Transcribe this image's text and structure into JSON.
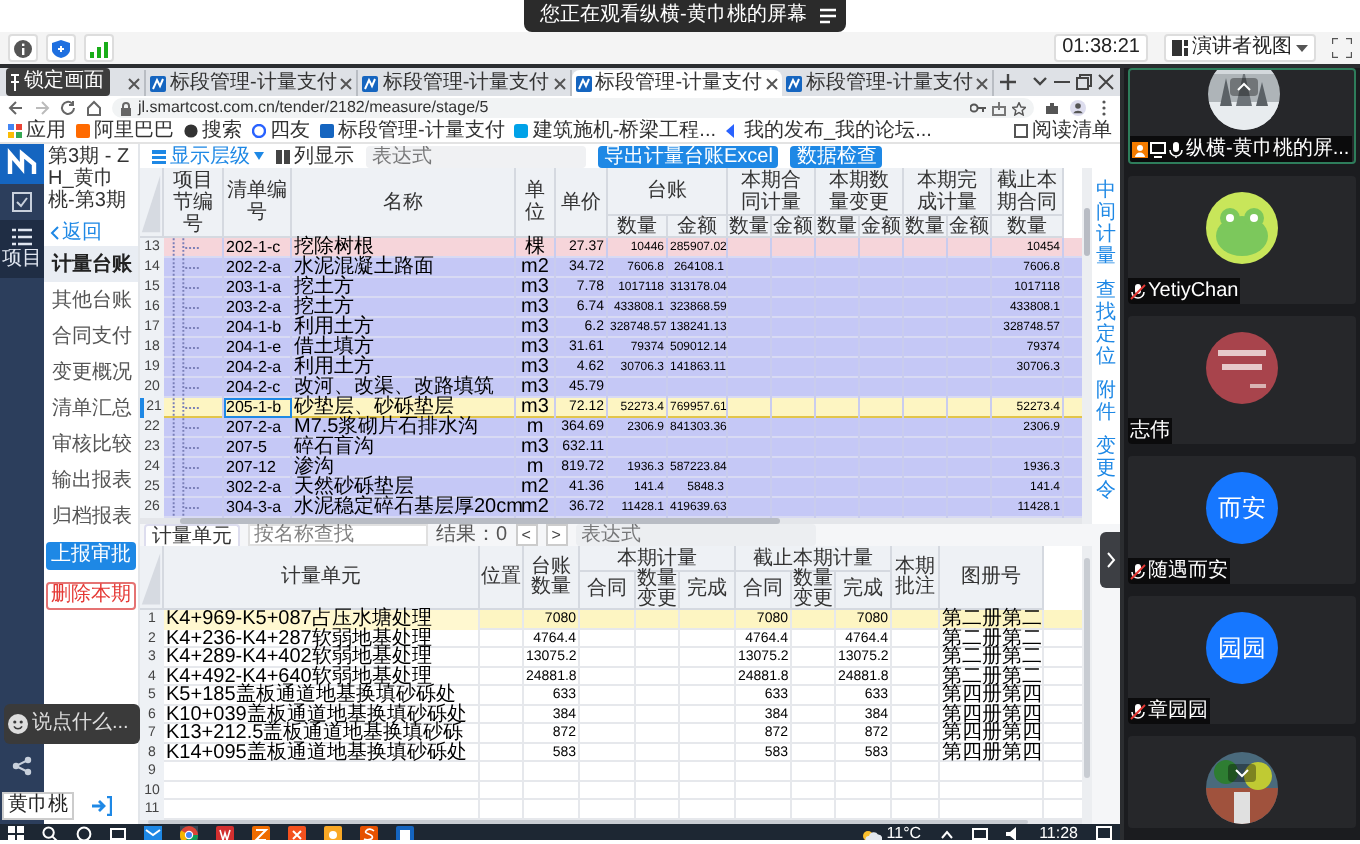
{
  "meeting": {
    "banner": "您正在观看纵横-黄巾桃的屏幕",
    "timer": "01:38:21",
    "view_button": "演讲者视图",
    "lock_overlay": "锁定画面",
    "chat_placeholder": "说点什么...",
    "presenter_label": "黄巾桃"
  },
  "browser": {
    "tabs": [
      {
        "selected": false
      },
      {
        "label": "标段管理-计量支付",
        "selected": false
      },
      {
        "label": "标段管理-计量支付",
        "selected": false
      },
      {
        "label": "标段管理-计量支付",
        "selected": true
      },
      {
        "label": "标段管理-计量支付",
        "selected": false
      }
    ],
    "address": "jl.smartcost.com.cn/tender/2182/measure/stage/5",
    "bookmarks": [
      "应用",
      "阿里巴巴",
      "搜索",
      "四友",
      "标段管理-计量支付",
      "建筑施机-桥梁工程...",
      "我的发布_我的论坛...",
      "阅读清单"
    ]
  },
  "app": {
    "period": "第3期 - ZH_黄巾桃-第3期",
    "rail": [
      {
        "selected": false
      },
      {
        "label": "项目",
        "selected": true
      }
    ],
    "back": "返回",
    "nav": [
      {
        "label": "计量台账",
        "selected": true
      },
      {
        "label": "其他台账",
        "selected": false
      },
      {
        "label": "合同支付",
        "selected": false
      },
      {
        "label": "变更概况",
        "selected": false
      },
      {
        "label": "清单汇总",
        "selected": false
      },
      {
        "label": "审核比较",
        "selected": false
      },
      {
        "label": "输出报表",
        "selected": false
      },
      {
        "label": "归档报表",
        "selected": false
      }
    ],
    "submit_button": "上报审批",
    "delete_button": "删除本期",
    "toolbar": {
      "level_dropdown": "显示层级",
      "columns_button": "列显示",
      "expression_placeholder": "表达式",
      "export_button": "导出计量台账Excel",
      "check_button": "数据检查"
    },
    "ledger": {
      "columns": [
        "项目节编号",
        "清单编号",
        "名称",
        "单位",
        "单价"
      ],
      "groups": [
        {
          "label": "台账",
          "sub": [
            "数量",
            "金额"
          ]
        },
        {
          "label": "本期合同计量",
          "sub": [
            "数量",
            "金额"
          ]
        },
        {
          "label": "本期数量变更",
          "sub": [
            "数量",
            "金额"
          ]
        },
        {
          "label": "本期完成计量",
          "sub": [
            "数量",
            "金额"
          ]
        },
        {
          "label": "截止本期合同",
          "sub": [
            "数量"
          ]
        }
      ],
      "rows": [
        {
          "no": "13",
          "code": "202-1-c",
          "name": "挖除树根",
          "unit": "棵",
          "price": "27.37",
          "ledger_qty": "10446",
          "ledger_amount": "285907.02",
          "to_date_qty": "10454",
          "flagged": true,
          "selected": false
        },
        {
          "no": "14",
          "code": "202-2-a",
          "name": "水泥混凝土路面",
          "unit": "m2",
          "price": "34.72",
          "ledger_qty": "7606.8",
          "ledger_amount": "264108.1",
          "to_date_qty": "7606.8",
          "flagged": false,
          "selected": false
        },
        {
          "no": "15",
          "code": "203-1-a",
          "name": "挖土方",
          "unit": "m3",
          "price": "7.78",
          "ledger_qty": "1017118",
          "ledger_amount": "313178.04",
          "to_date_qty": "1017118",
          "flagged": false,
          "selected": false
        },
        {
          "no": "16",
          "code": "203-2-a",
          "name": "挖土方",
          "unit": "m3",
          "price": "6.74",
          "ledger_qty": "433808.1",
          "ledger_amount": "323868.59",
          "to_date_qty": "433808.1",
          "flagged": false,
          "selected": false
        },
        {
          "no": "17",
          "code": "204-1-b",
          "name": "利用土方",
          "unit": "m3",
          "price": "6.2",
          "ledger_qty": "328748.57",
          "ledger_amount": "138241.13",
          "to_date_qty": "328748.57",
          "flagged": false,
          "selected": false
        },
        {
          "no": "18",
          "code": "204-1-e",
          "name": "借土填方",
          "unit": "m3",
          "price": "31.61",
          "ledger_qty": "79374",
          "ledger_amount": "509012.14",
          "to_date_qty": "79374",
          "flagged": false,
          "selected": false
        },
        {
          "no": "19",
          "code": "204-2-a",
          "name": "利用土方",
          "unit": "m3",
          "price": "4.62",
          "ledger_qty": "30706.3",
          "ledger_amount": "141863.11",
          "to_date_qty": "30706.3",
          "flagged": false,
          "selected": false
        },
        {
          "no": "20",
          "code": "204-2-c",
          "name": "改河、改渠、改路填筑",
          "unit": "m3",
          "price": "45.79",
          "flagged": false,
          "selected": false
        },
        {
          "no": "21",
          "code": "205-1-b",
          "name": "砂垫层、砂砾垫层",
          "unit": "m3",
          "price": "72.12",
          "ledger_qty": "52273.4",
          "ledger_amount": "769957.61",
          "to_date_qty": "52273.4",
          "flagged": false,
          "selected": true
        },
        {
          "no": "22",
          "code": "207-2-a",
          "name": "M7.5浆砌片石排水沟",
          "unit": "m",
          "price": "364.69",
          "ledger_qty": "2306.9",
          "ledger_amount": "841303.36",
          "to_date_qty": "2306.9",
          "flagged": false,
          "selected": false
        },
        {
          "no": "23",
          "code": "207-5",
          "name": "碎石盲沟",
          "unit": "m3",
          "price": "632.11",
          "flagged": false,
          "selected": false
        },
        {
          "no": "24",
          "code": "207-12",
          "name": "渗沟",
          "unit": "m",
          "price": "819.72",
          "ledger_qty": "1936.3",
          "ledger_amount": "587223.84",
          "to_date_qty": "1936.3",
          "flagged": false,
          "selected": false
        },
        {
          "no": "25",
          "code": "302-2-a",
          "name": "天然砂砾垫层",
          "unit": "m2",
          "price": "41.36",
          "ledger_qty": "141.4",
          "ledger_amount": "5848.3",
          "to_date_qty": "141.4",
          "flagged": false,
          "selected": false
        },
        {
          "no": "26",
          "code": "304-3-a",
          "name": "水泥稳定碎石基层厚20cm",
          "unit": "m2",
          "price": "36.72",
          "ledger_qty": "11428.1",
          "ledger_amount": "419639.63",
          "to_date_qty": "11428.1",
          "flagged": false,
          "selected": false
        }
      ]
    },
    "side_links": [
      "中间计量",
      "查找定位",
      "附件",
      "变更令"
    ],
    "units": {
      "tab": {
        "label": "计量单元",
        "selected": true
      },
      "search_placeholder": "按名称查找",
      "result": "结果：0",
      "prev": "<",
      "next": ">",
      "expression_placeholder": "表达式",
      "columns": [
        "计量单元",
        "位置",
        "台账数量"
      ],
      "groups": [
        {
          "label": "本期计量",
          "sub": [
            "合同",
            "数量变更",
            "完成"
          ]
        },
        {
          "label": "截止本期计量",
          "sub": [
            "合同",
            "数量变更",
            "完成"
          ]
        }
      ],
      "tail_columns": [
        "本期批注",
        "图册号"
      ],
      "rows": [
        {
          "no": "1",
          "unit": "K4+969-K5+087占压水塘处理",
          "ledger_qty": "7080",
          "to_date_contract": "7080",
          "to_date_done": "7080",
          "atlas": "第二册第二",
          "selected": true
        },
        {
          "no": "2",
          "unit": "K4+236-K4+287软弱地基处理",
          "ledger_qty": "4764.4",
          "to_date_contract": "4764.4",
          "to_date_done": "4764.4",
          "atlas": "第二册第二",
          "selected": false
        },
        {
          "no": "3",
          "unit": "K4+289-K4+402软弱地基处理",
          "ledger_qty": "13075.2",
          "to_date_contract": "13075.2",
          "to_date_done": "13075.2",
          "atlas": "第二册第二",
          "selected": false
        },
        {
          "no": "4",
          "unit": "K4+492-K4+640软弱地基处理",
          "ledger_qty": "24881.8",
          "to_date_contract": "24881.8",
          "to_date_done": "24881.8",
          "atlas": "第二册第二",
          "selected": false
        },
        {
          "no": "5",
          "unit": "K5+185盖板通道地基换填砂砾处",
          "ledger_qty": "633",
          "to_date_contract": "633",
          "to_date_done": "633",
          "atlas": "第四册第四",
          "selected": false
        },
        {
          "no": "6",
          "unit": "K10+039盖板通道地基换填砂砾处",
          "ledger_qty": "384",
          "to_date_contract": "384",
          "to_date_done": "384",
          "atlas": "第四册第四",
          "selected": false
        },
        {
          "no": "7",
          "unit": "K13+212.5盖板通道地基换填砂砾",
          "ledger_qty": "872",
          "to_date_contract": "872",
          "to_date_done": "872",
          "atlas": "第四册第四",
          "selected": false
        },
        {
          "no": "8",
          "unit": "K14+095盖板通道地基换填砂砾处",
          "ledger_qty": "583",
          "to_date_contract": "583",
          "to_date_done": "583",
          "atlas": "第四册第四",
          "selected": false
        },
        {
          "no": "9",
          "selected": false
        },
        {
          "no": "10",
          "selected": false
        },
        {
          "no": "11",
          "selected": false
        }
      ]
    }
  },
  "participants": [
    {
      "name": "纵横-黄巾桃的屏...",
      "kind": "picture",
      "host": true,
      "sharing": true,
      "mic_on": true,
      "muted": false,
      "active": true
    },
    {
      "name": "YetiyChan",
      "kind": "picture",
      "host": false,
      "sharing": false,
      "mic_on": false,
      "muted": true,
      "active": false
    },
    {
      "name": "志伟",
      "kind": "picture",
      "host": false,
      "sharing": false,
      "mic_on": false,
      "muted": false,
      "active": false
    },
    {
      "name": "随遇而安",
      "kind": "initials",
      "initials": "而安",
      "host": false,
      "sharing": false,
      "mic_on": false,
      "muted": true,
      "active": false
    },
    {
      "name": "章园园",
      "kind": "initials",
      "initials": "园园",
      "host": false,
      "sharing": false,
      "mic_on": false,
      "muted": true,
      "active": false
    },
    {
      "kind": "picture",
      "active": false
    }
  ],
  "taskbar": {
    "weather": "11°C",
    "time": "11:28"
  }
}
